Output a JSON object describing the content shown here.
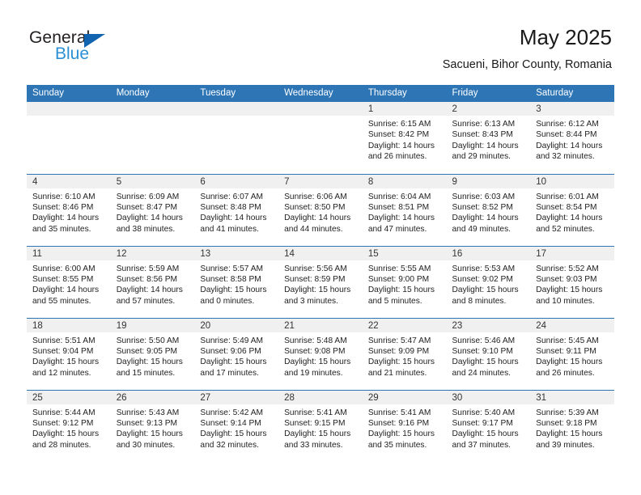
{
  "logo": {
    "text_primary": "General",
    "text_secondary": "Blue",
    "flag_color": "#1263b0",
    "secondary_color": "#2a8fd4"
  },
  "header": {
    "title": "May 2025",
    "subtitle": "Sacueni, Bihor County, Romania"
  },
  "theme": {
    "header_bg": "#2e75b6",
    "header_text": "#ffffff",
    "daynum_bg": "#f0f0f0",
    "row_divider": "#2e75b6"
  },
  "calendar": {
    "weekday_headers": [
      "Sunday",
      "Monday",
      "Tuesday",
      "Wednesday",
      "Thursday",
      "Friday",
      "Saturday"
    ],
    "weeks": [
      [
        {
          "day": "",
          "empty": true
        },
        {
          "day": "",
          "empty": true
        },
        {
          "day": "",
          "empty": true
        },
        {
          "day": "",
          "empty": true
        },
        {
          "day": "1",
          "sunrise": "Sunrise: 6:15 AM",
          "sunset": "Sunset: 8:42 PM",
          "daylight_1": "Daylight: 14 hours",
          "daylight_2": "and 26 minutes."
        },
        {
          "day": "2",
          "sunrise": "Sunrise: 6:13 AM",
          "sunset": "Sunset: 8:43 PM",
          "daylight_1": "Daylight: 14 hours",
          "daylight_2": "and 29 minutes."
        },
        {
          "day": "3",
          "sunrise": "Sunrise: 6:12 AM",
          "sunset": "Sunset: 8:44 PM",
          "daylight_1": "Daylight: 14 hours",
          "daylight_2": "and 32 minutes."
        }
      ],
      [
        {
          "day": "4",
          "sunrise": "Sunrise: 6:10 AM",
          "sunset": "Sunset: 8:46 PM",
          "daylight_1": "Daylight: 14 hours",
          "daylight_2": "and 35 minutes."
        },
        {
          "day": "5",
          "sunrise": "Sunrise: 6:09 AM",
          "sunset": "Sunset: 8:47 PM",
          "daylight_1": "Daylight: 14 hours",
          "daylight_2": "and 38 minutes."
        },
        {
          "day": "6",
          "sunrise": "Sunrise: 6:07 AM",
          "sunset": "Sunset: 8:48 PM",
          "daylight_1": "Daylight: 14 hours",
          "daylight_2": "and 41 minutes."
        },
        {
          "day": "7",
          "sunrise": "Sunrise: 6:06 AM",
          "sunset": "Sunset: 8:50 PM",
          "daylight_1": "Daylight: 14 hours",
          "daylight_2": "and 44 minutes."
        },
        {
          "day": "8",
          "sunrise": "Sunrise: 6:04 AM",
          "sunset": "Sunset: 8:51 PM",
          "daylight_1": "Daylight: 14 hours",
          "daylight_2": "and 47 minutes."
        },
        {
          "day": "9",
          "sunrise": "Sunrise: 6:03 AM",
          "sunset": "Sunset: 8:52 PM",
          "daylight_1": "Daylight: 14 hours",
          "daylight_2": "and 49 minutes."
        },
        {
          "day": "10",
          "sunrise": "Sunrise: 6:01 AM",
          "sunset": "Sunset: 8:54 PM",
          "daylight_1": "Daylight: 14 hours",
          "daylight_2": "and 52 minutes."
        }
      ],
      [
        {
          "day": "11",
          "sunrise": "Sunrise: 6:00 AM",
          "sunset": "Sunset: 8:55 PM",
          "daylight_1": "Daylight: 14 hours",
          "daylight_2": "and 55 minutes."
        },
        {
          "day": "12",
          "sunrise": "Sunrise: 5:59 AM",
          "sunset": "Sunset: 8:56 PM",
          "daylight_1": "Daylight: 14 hours",
          "daylight_2": "and 57 minutes."
        },
        {
          "day": "13",
          "sunrise": "Sunrise: 5:57 AM",
          "sunset": "Sunset: 8:58 PM",
          "daylight_1": "Daylight: 15 hours",
          "daylight_2": "and 0 minutes."
        },
        {
          "day": "14",
          "sunrise": "Sunrise: 5:56 AM",
          "sunset": "Sunset: 8:59 PM",
          "daylight_1": "Daylight: 15 hours",
          "daylight_2": "and 3 minutes."
        },
        {
          "day": "15",
          "sunrise": "Sunrise: 5:55 AM",
          "sunset": "Sunset: 9:00 PM",
          "daylight_1": "Daylight: 15 hours",
          "daylight_2": "and 5 minutes."
        },
        {
          "day": "16",
          "sunrise": "Sunrise: 5:53 AM",
          "sunset": "Sunset: 9:02 PM",
          "daylight_1": "Daylight: 15 hours",
          "daylight_2": "and 8 minutes."
        },
        {
          "day": "17",
          "sunrise": "Sunrise: 5:52 AM",
          "sunset": "Sunset: 9:03 PM",
          "daylight_1": "Daylight: 15 hours",
          "daylight_2": "and 10 minutes."
        }
      ],
      [
        {
          "day": "18",
          "sunrise": "Sunrise: 5:51 AM",
          "sunset": "Sunset: 9:04 PM",
          "daylight_1": "Daylight: 15 hours",
          "daylight_2": "and 12 minutes."
        },
        {
          "day": "19",
          "sunrise": "Sunrise: 5:50 AM",
          "sunset": "Sunset: 9:05 PM",
          "daylight_1": "Daylight: 15 hours",
          "daylight_2": "and 15 minutes."
        },
        {
          "day": "20",
          "sunrise": "Sunrise: 5:49 AM",
          "sunset": "Sunset: 9:06 PM",
          "daylight_1": "Daylight: 15 hours",
          "daylight_2": "and 17 minutes."
        },
        {
          "day": "21",
          "sunrise": "Sunrise: 5:48 AM",
          "sunset": "Sunset: 9:08 PM",
          "daylight_1": "Daylight: 15 hours",
          "daylight_2": "and 19 minutes."
        },
        {
          "day": "22",
          "sunrise": "Sunrise: 5:47 AM",
          "sunset": "Sunset: 9:09 PM",
          "daylight_1": "Daylight: 15 hours",
          "daylight_2": "and 21 minutes."
        },
        {
          "day": "23",
          "sunrise": "Sunrise: 5:46 AM",
          "sunset": "Sunset: 9:10 PM",
          "daylight_1": "Daylight: 15 hours",
          "daylight_2": "and 24 minutes."
        },
        {
          "day": "24",
          "sunrise": "Sunrise: 5:45 AM",
          "sunset": "Sunset: 9:11 PM",
          "daylight_1": "Daylight: 15 hours",
          "daylight_2": "and 26 minutes."
        }
      ],
      [
        {
          "day": "25",
          "sunrise": "Sunrise: 5:44 AM",
          "sunset": "Sunset: 9:12 PM",
          "daylight_1": "Daylight: 15 hours",
          "daylight_2": "and 28 minutes."
        },
        {
          "day": "26",
          "sunrise": "Sunrise: 5:43 AM",
          "sunset": "Sunset: 9:13 PM",
          "daylight_1": "Daylight: 15 hours",
          "daylight_2": "and 30 minutes."
        },
        {
          "day": "27",
          "sunrise": "Sunrise: 5:42 AM",
          "sunset": "Sunset: 9:14 PM",
          "daylight_1": "Daylight: 15 hours",
          "daylight_2": "and 32 minutes."
        },
        {
          "day": "28",
          "sunrise": "Sunrise: 5:41 AM",
          "sunset": "Sunset: 9:15 PM",
          "daylight_1": "Daylight: 15 hours",
          "daylight_2": "and 33 minutes."
        },
        {
          "day": "29",
          "sunrise": "Sunrise: 5:41 AM",
          "sunset": "Sunset: 9:16 PM",
          "daylight_1": "Daylight: 15 hours",
          "daylight_2": "and 35 minutes."
        },
        {
          "day": "30",
          "sunrise": "Sunrise: 5:40 AM",
          "sunset": "Sunset: 9:17 PM",
          "daylight_1": "Daylight: 15 hours",
          "daylight_2": "and 37 minutes."
        },
        {
          "day": "31",
          "sunrise": "Sunrise: 5:39 AM",
          "sunset": "Sunset: 9:18 PM",
          "daylight_1": "Daylight: 15 hours",
          "daylight_2": "and 39 minutes."
        }
      ]
    ]
  }
}
